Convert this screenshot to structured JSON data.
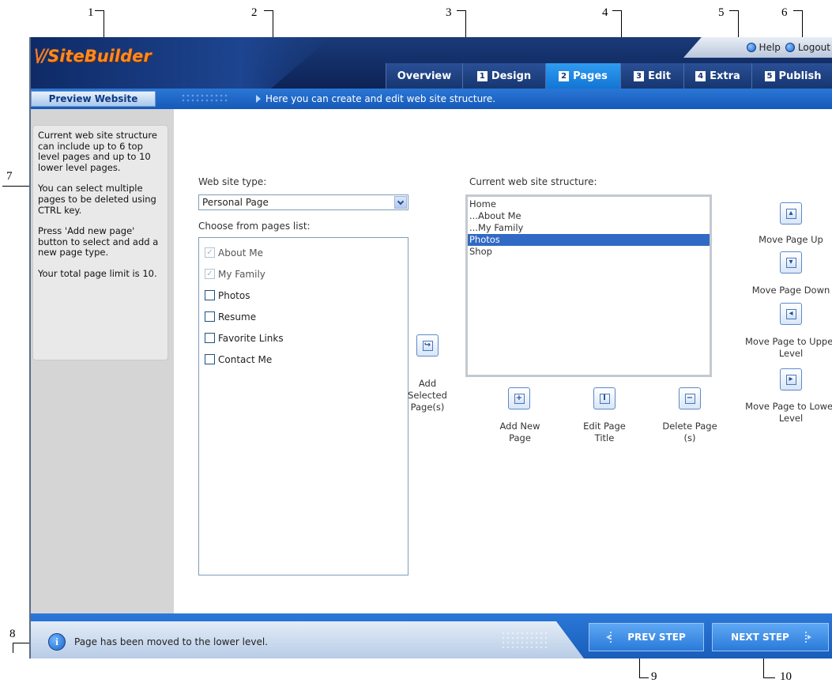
{
  "callouts": [
    "1",
    "2",
    "3",
    "4",
    "5",
    "6",
    "7",
    "8",
    "9",
    "10"
  ],
  "app": {
    "logo_text": "SiteBuilder",
    "logo_mark": "\\//",
    "top_links": {
      "help": "Help",
      "logout": "Logout"
    },
    "tabs": [
      {
        "num": "",
        "label": "Overview",
        "active": false
      },
      {
        "num": "1",
        "label": "Design",
        "active": false
      },
      {
        "num": "2",
        "label": "Pages",
        "active": true
      },
      {
        "num": "3",
        "label": "Edit",
        "active": false
      },
      {
        "num": "4",
        "label": "Extra",
        "active": false
      },
      {
        "num": "5",
        "label": "Publish",
        "active": false
      }
    ],
    "preview_button": "Preview Website",
    "info_message": "Here you can create and edit web site structure."
  },
  "sidebar": {
    "paragraphs": [
      "Current web site structure can include up to 6 top level pages and up to 10 lower level pages.",
      "You can select multiple pages to be deleted using CTRL key.",
      "Press 'Add new page' button to select and add a new page type.",
      "Your total page limit is 10."
    ]
  },
  "main": {
    "site_type_label": "Web site type:",
    "site_type_value": "Personal Page",
    "pages_list_label": "Choose from pages list:",
    "pages_list": [
      {
        "label": "About Me",
        "checked": true,
        "disabled": true
      },
      {
        "label": "My Family",
        "checked": true,
        "disabled": true
      },
      {
        "label": "Photos",
        "checked": false,
        "disabled": false
      },
      {
        "label": "Resume",
        "checked": false,
        "disabled": false
      },
      {
        "label": "Favorite Links",
        "checked": false,
        "disabled": false
      },
      {
        "label": "Contact Me",
        "checked": false,
        "disabled": false
      }
    ],
    "add_selected_label": "Add Selected Page(s)",
    "structure_label": "Current web site structure:",
    "structure_items": [
      {
        "label": "Home",
        "selected": false
      },
      {
        "label": "...About Me",
        "selected": false
      },
      {
        "label": "...My Family",
        "selected": false
      },
      {
        "label": "Photos",
        "selected": true
      },
      {
        "label": "Shop",
        "selected": false
      }
    ],
    "add_new_page_label": "Add New Page",
    "edit_page_title_label": "Edit Page Title",
    "delete_page_label": "Delete Page (s)",
    "move_up_label": "Move Page Up",
    "move_down_label": "Move Page Down",
    "move_upper_label": "Move Page to Upper Level",
    "move_lower_label": "Move Page to Lower Level"
  },
  "footer": {
    "status_message": "Page has been moved to the lower level.",
    "prev_step": "PREV STEP",
    "next_step": "NEXT STEP"
  },
  "colors": {
    "header_dark": "#0d2356",
    "tab_active": "#1275d4",
    "bar_blue": "#1659b8",
    "selection": "#316ac5",
    "logo_orange": "#ff8a1e"
  }
}
